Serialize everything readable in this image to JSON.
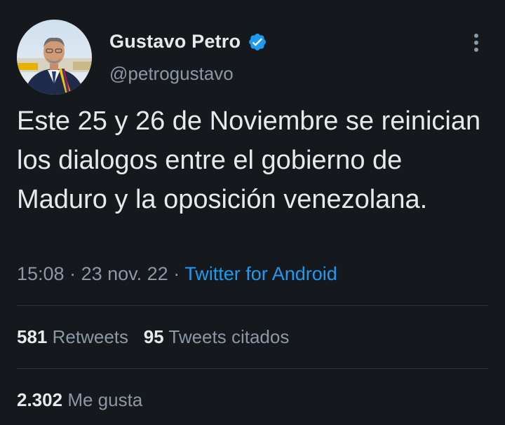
{
  "author": {
    "name": "Gustavo Petro",
    "handle": "@petrogustavo",
    "verified": true
  },
  "tweet": {
    "text": "Este 25 y 26 de Noviembre se reinician los dialogos entre el gobierno de Maduro y la oposición venezolana."
  },
  "meta": {
    "time": "15:08",
    "sep1": " · ",
    "date": "23 nov. 22",
    "sep2": " · ",
    "source": "Twitter for Android"
  },
  "stats": {
    "retweets_count": "581",
    "retweets_label": "Retweets",
    "quotes_count": "95",
    "quotes_label": "Tweets citados",
    "likes_count": "2.302",
    "likes_label": "Me gusta"
  },
  "icons": {
    "verified": "verified-badge-icon",
    "more": "more-vertical-icon"
  },
  "colors": {
    "background": "#15181c",
    "text_primary": "#e7e9ea",
    "text_secondary": "#8b98a5",
    "link": "#1d9bf0",
    "verified": "#1d9bf0"
  }
}
